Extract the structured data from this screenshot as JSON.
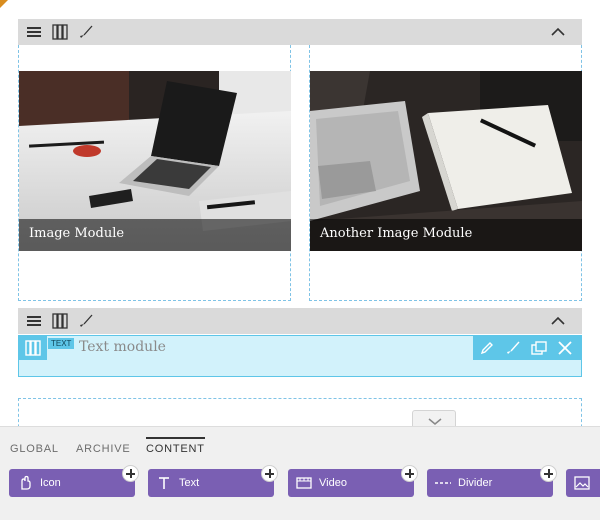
{
  "rows": [
    {
      "toolbar": {
        "icons": [
          "menu-icon",
          "columns-icon",
          "brush-icon"
        ],
        "collapse_icon": "chevron-up-icon"
      },
      "modules": [
        {
          "type": "image",
          "caption": "Image Module"
        },
        {
          "type": "image",
          "caption": "Another Image Module"
        }
      ]
    },
    {
      "toolbar": {
        "icons": [
          "menu-icon",
          "columns-icon",
          "brush-icon"
        ],
        "collapse_icon": "chevron-up-icon"
      },
      "text_module": {
        "badge": "TEXT",
        "content": "Text module",
        "actions": [
          "pencil-icon",
          "brush-icon",
          "duplicate-icon",
          "close-icon"
        ]
      }
    }
  ],
  "panel": {
    "tabs": [
      {
        "label": "GLOBAL",
        "active": false
      },
      {
        "label": "ARCHIVE",
        "active": false
      },
      {
        "label": "CONTENT",
        "active": true
      }
    ],
    "modules": [
      {
        "label": "Icon",
        "icon": "hand-icon"
      },
      {
        "label": "Text",
        "icon": "text-icon"
      },
      {
        "label": "Video",
        "icon": "film-icon"
      },
      {
        "label": "Divider",
        "icon": "divider-icon"
      },
      {
        "label": "",
        "icon": "image-icon"
      }
    ]
  },
  "colors": {
    "accent_blue": "#5ec6e8",
    "module_purple": "#7a5fb3",
    "toolbar_gray": "#dadada"
  }
}
